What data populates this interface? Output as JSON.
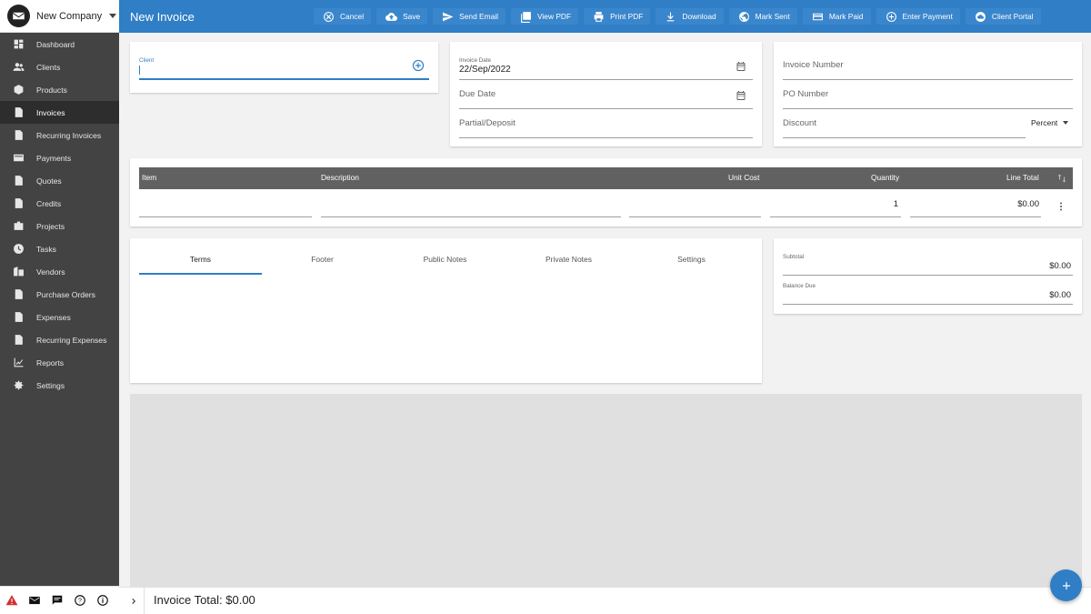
{
  "company": {
    "name": "New Company"
  },
  "sidebar": {
    "items": [
      {
        "label": "Dashboard",
        "icon": "dashboard-icon"
      },
      {
        "label": "Clients",
        "icon": "clients-icon"
      },
      {
        "label": "Products",
        "icon": "products-icon"
      },
      {
        "label": "Invoices",
        "icon": "invoices-icon",
        "active": true
      },
      {
        "label": "Recurring Invoices",
        "icon": "recurring-invoices-icon"
      },
      {
        "label": "Payments",
        "icon": "payments-icon"
      },
      {
        "label": "Quotes",
        "icon": "quotes-icon"
      },
      {
        "label": "Credits",
        "icon": "credits-icon"
      },
      {
        "label": "Projects",
        "icon": "projects-icon"
      },
      {
        "label": "Tasks",
        "icon": "tasks-icon"
      },
      {
        "label": "Vendors",
        "icon": "vendors-icon"
      },
      {
        "label": "Purchase Orders",
        "icon": "purchase-orders-icon"
      },
      {
        "label": "Expenses",
        "icon": "expenses-icon"
      },
      {
        "label": "Recurring Expenses",
        "icon": "recurring-expenses-icon"
      },
      {
        "label": "Reports",
        "icon": "reports-icon"
      },
      {
        "label": "Settings",
        "icon": "settings-icon"
      }
    ]
  },
  "header": {
    "title": "New Invoice",
    "actions": {
      "cancel": "Cancel",
      "save": "Save",
      "send_email": "Send Email",
      "view_pdf": "View PDF",
      "print_pdf": "Print PDF",
      "download": "Download",
      "mark_sent": "Mark Sent",
      "mark_paid": "Mark Paid",
      "enter_payment": "Enter Payment",
      "client_portal": "Client Portal"
    }
  },
  "client": {
    "label": "Client",
    "value": ""
  },
  "dates": {
    "invoice_date_label": "Invoice Date",
    "invoice_date_value": "22/Sep/2022",
    "due_date_label": "Due Date",
    "partial_label": "Partial/Deposit"
  },
  "numbers": {
    "invoice_number_label": "Invoice Number",
    "po_number_label": "PO Number",
    "discount_label": "Discount",
    "discount_type": "Percent"
  },
  "items_table": {
    "columns": {
      "item": "Item",
      "description": "Description",
      "unit_cost": "Unit Cost",
      "quantity": "Quantity",
      "line_total": "Line Total"
    },
    "row": {
      "quantity": "1",
      "line_total": "$0.00"
    }
  },
  "tabs": [
    "Terms",
    "Footer",
    "Public Notes",
    "Private Notes",
    "Settings"
  ],
  "totals": {
    "subtotal_label": "Subtotal",
    "subtotal_value": "$0.00",
    "balance_label": "Balance Due",
    "balance_value": "$0.00"
  },
  "footer": {
    "invoice_total": "Invoice Total: $0.00"
  },
  "colors": {
    "primary": "#2f7ec6",
    "sidebar": "#434343",
    "table_header": "#616161"
  }
}
